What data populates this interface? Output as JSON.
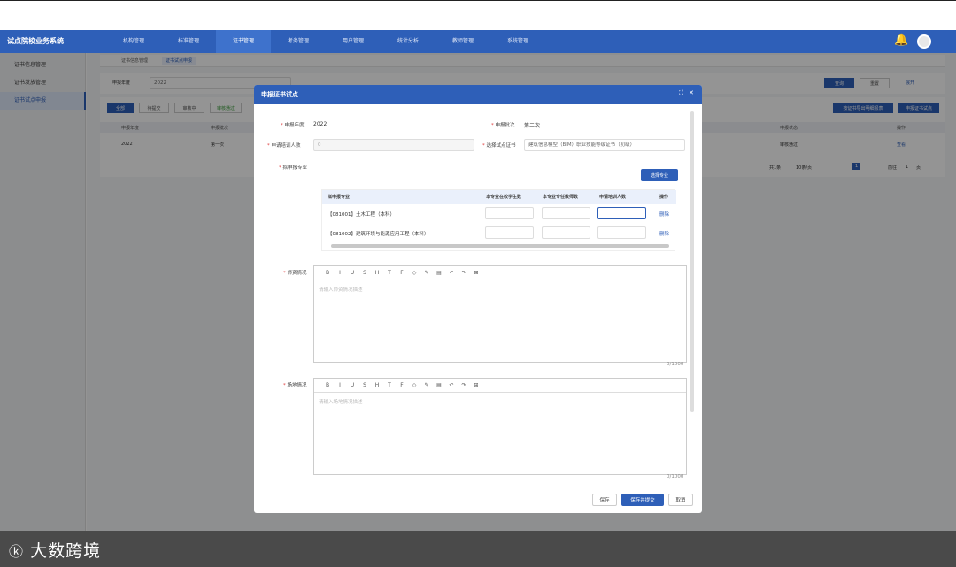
{
  "app": {
    "title": "试点院校业务系统"
  },
  "nav": [
    "机构管理",
    "标准管理",
    "证书管理",
    "考务管理",
    "用户管理",
    "统计分析",
    "教师管理",
    "系统管理"
  ],
  "sidebar": [
    "证书信息管理",
    "证书发放管理",
    "证书试点申报"
  ],
  "tabs": [
    "证书信息管理",
    "证书试点申报"
  ],
  "filter": {
    "label": "申报年度",
    "value": "2022",
    "query": "查询",
    "reset": "重置",
    "expand": "展开"
  },
  "list": {
    "actions": [
      "全部",
      "待提交",
      "审核中",
      "审核通过"
    ],
    "right_buttons": [
      "按证书导出明细报表",
      "申报证书试点"
    ],
    "headers": [
      "申报年度",
      "申报批次",
      "申报状态",
      "操作"
    ],
    "row": {
      "year": "2022",
      "batch": "第一次",
      "status": "审核通过",
      "op": "查看"
    },
    "pager": {
      "total": "共1条",
      "per": "10条/页",
      "page": "1",
      "goto": "前往",
      "gpage": "1",
      "unit": "页"
    }
  },
  "modal": {
    "title": "申报证书试点",
    "year_label": "申报年度",
    "year_value": "2022",
    "batch_label": "申报批次",
    "batch_value": "第二次",
    "count_label": "申请培训人数",
    "count_placeholder": "0",
    "cert_label": "选择试点证书",
    "cert_value": "建筑信息模型（BIM）职业技能等级证书（初级）",
    "major_label": "拟申报专业",
    "select_major": "选择专业",
    "table_headers": [
      "拟申报专业",
      "本专业在校学生数",
      "本专业专任教师数",
      "申请培训人数",
      "操作"
    ],
    "majors": [
      {
        "name": "【081001】土木工程（本科）",
        "op": "删除"
      },
      {
        "name": "【081002】建筑环境与能源应用工程（本科）",
        "op": "删除"
      }
    ],
    "teacher_label": "师资情况",
    "teacher_placeholder": "请输入师资情况描述",
    "teacher_count": "0/1000",
    "site_label": "场地情况",
    "site_placeholder": "请输入场地情况描述",
    "site_count": "0/1000",
    "toolbar": [
      "B",
      "I",
      "U",
      "S",
      "H",
      "T",
      "F",
      "◇",
      "✎",
      "▤",
      "↶",
      "↷",
      "⊞"
    ],
    "buttons": {
      "save": "保存",
      "submit": "保存并提交",
      "cancel": "取消"
    }
  },
  "watermark": "大数跨境"
}
